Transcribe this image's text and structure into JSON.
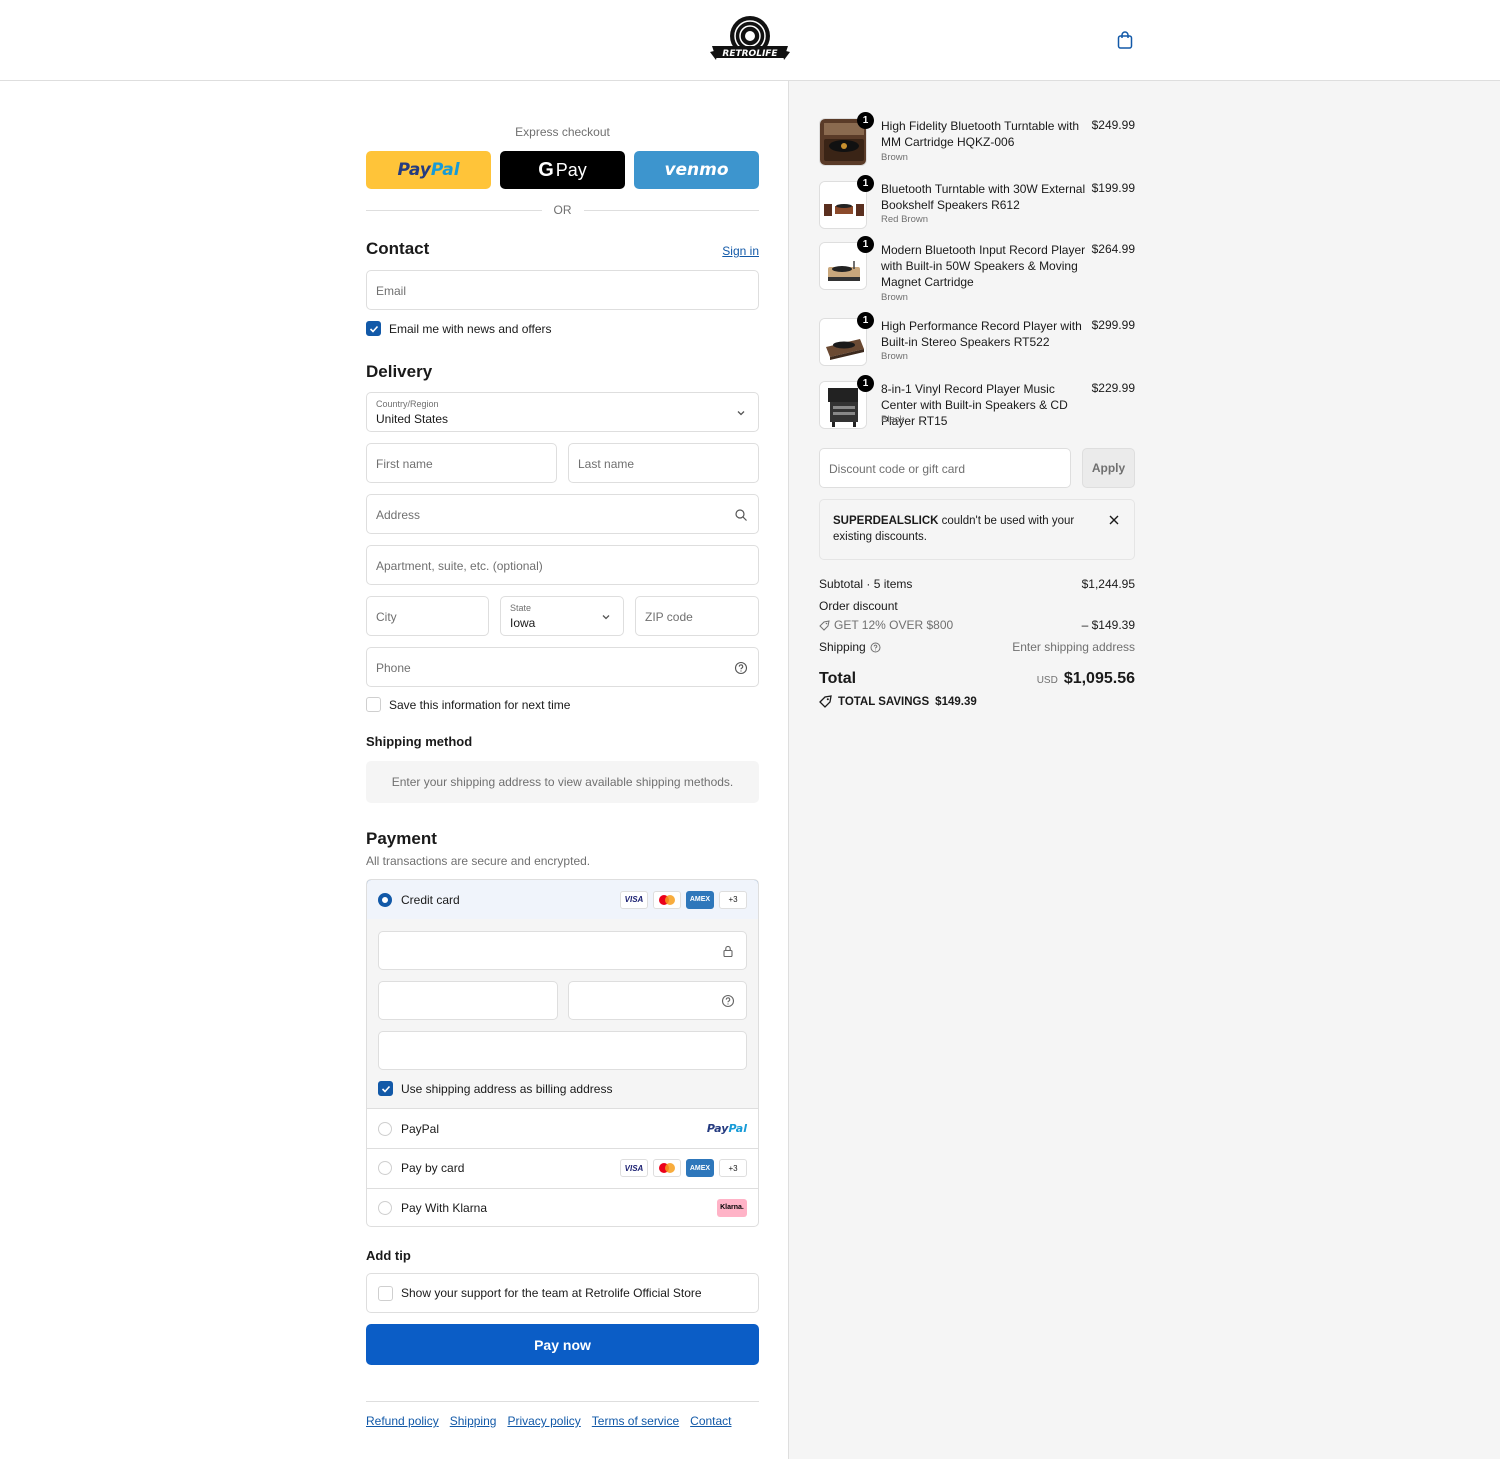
{
  "brand": {
    "logo_text": "RETROLIFE"
  },
  "header": {
    "cart_icon": "shopping-bag-icon"
  },
  "express": {
    "label": "Express checkout",
    "paypal_a": "Pay",
    "paypal_b": "Pal",
    "gpay_label": "Pay",
    "venmo_label": "venmo",
    "or_label": "OR"
  },
  "contact": {
    "title": "Contact",
    "sign_in": "Sign in",
    "email_placeholder": "Email",
    "news_label": "Email me with news and offers",
    "news_checked": true
  },
  "delivery": {
    "title": "Delivery",
    "country_label": "Country/Region",
    "country_value": "United States",
    "first_name": "First name",
    "last_name": "Last name",
    "address": "Address",
    "apartment": "Apartment, suite, etc. (optional)",
    "city": "City",
    "state_label": "State",
    "state_value": "Iowa",
    "zip": "ZIP code",
    "phone": "Phone",
    "save_label": "Save this information for next time",
    "save_checked": false
  },
  "shipping_method": {
    "title": "Shipping method",
    "message": "Enter your shipping address to view available shipping methods."
  },
  "payment": {
    "title": "Payment",
    "subtitle": "All transactions are secure and encrypted.",
    "options": [
      {
        "label": "Credit card",
        "selected": true
      },
      {
        "label": "PayPal",
        "selected": false
      },
      {
        "label": "Pay by card",
        "selected": false
      },
      {
        "label": "Pay With Klarna",
        "selected": false
      }
    ],
    "card_visa": "VISA",
    "card_amex": "AMEX",
    "card_more": "+3",
    "klarna_badge": "Klarna.",
    "pp_a": "Pay",
    "pp_b": "Pal",
    "billing_label": "Use shipping address as billing address",
    "billing_checked": true
  },
  "tip": {
    "title": "Add tip",
    "label": "Show your support for the team at Retrolife Official Store"
  },
  "pay_now": "Pay now",
  "footer_links": [
    "Refund policy",
    "Shipping",
    "Privacy policy",
    "Terms of service",
    "Contact"
  ],
  "cart": {
    "items": [
      {
        "qty": "1",
        "name": "High Fidelity Bluetooth Turntable with MM Cartridge HQKZ-006",
        "variant": "Brown",
        "price": "$249.99"
      },
      {
        "qty": "1",
        "name": "Bluetooth Turntable with 30W External Bookshelf Speakers R612",
        "variant": "Red Brown",
        "price": "$199.99"
      },
      {
        "qty": "1",
        "name": "Modern Bluetooth Input Record Player with Built-in 50W Speakers & Moving Magnet Cartridge",
        "variant": "Brown",
        "price": "$264.99"
      },
      {
        "qty": "1",
        "name": "High Performance Record Player with Built-in Stereo Speakers RT522",
        "variant": "Brown",
        "price": "$299.99"
      },
      {
        "qty": "1",
        "name": "8-in-1 Vinyl Record Player Music Center with Built-in Speakers & CD Player RT15",
        "variant": "Black",
        "price": "$229.99"
      }
    ],
    "discount_placeholder": "Discount code or gift card",
    "apply_label": "Apply",
    "warning_code": "SUPERDEALSLICK",
    "warning_text": " couldn't be used with your existing discounts.",
    "subtotal_label": "Subtotal · 5 items",
    "subtotal_value": "$1,244.95",
    "order_discount_label": "Order discount",
    "discount_code": "GET 12% OVER $800",
    "discount_value": "– $149.39",
    "shipping_label": "Shipping",
    "shipping_value": "Enter shipping address",
    "total_label": "Total",
    "currency": "USD",
    "total_value": "$1,095.56",
    "savings_label": "TOTAL SAVINGS",
    "savings_value": "$149.39"
  },
  "colors": {
    "primary": "#0b5dc6",
    "link": "#1259a8",
    "paypal": "#ffc439",
    "venmo": "#3d95ce"
  }
}
